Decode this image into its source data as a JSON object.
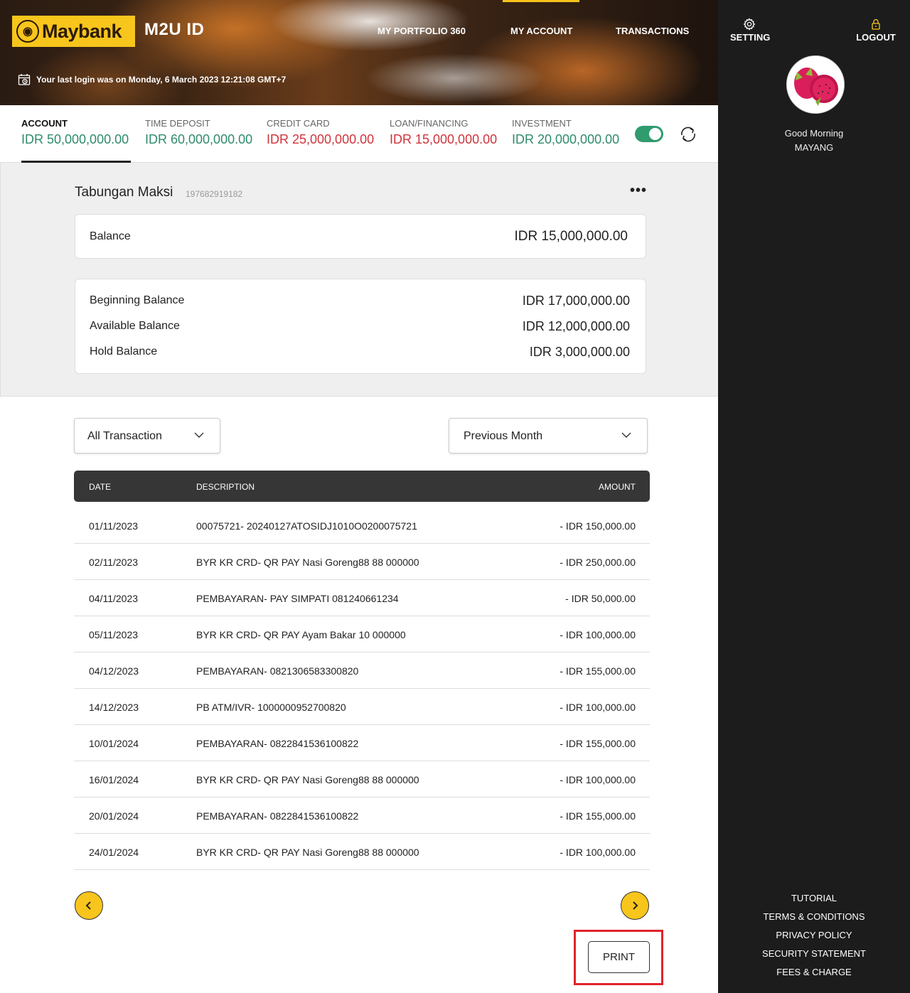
{
  "header": {
    "logo_text": "Maybank",
    "app_title": "M2U ID",
    "nav": [
      "MY PORTFOLIO 360",
      "MY ACCOUNT",
      "TRANSACTIONS"
    ],
    "last_login": "Your last login was on Monday, 6 March 2023 12:21:08 GMT+7"
  },
  "summary": {
    "tabs": [
      {
        "label": "ACCOUNT",
        "value": "IDR 50,000,000.00",
        "color": "#2f8b6b",
        "active": true
      },
      {
        "label": "TIME DEPOSIT",
        "value": "IDR 60,000,000.00",
        "color": "#2f8b6b"
      },
      {
        "label": "CREDIT CARD",
        "value": "IDR 25,000,000.00",
        "color": "#d0343b"
      },
      {
        "label": "LOAN/FINANCING",
        "value": "IDR 15,000,000.00",
        "color": "#d0343b"
      },
      {
        "label": "INVESTMENT",
        "value": "IDR 20,000,000.00",
        "color": "#2f8b6b"
      }
    ],
    "toggle_on": true
  },
  "account": {
    "name": "Tabungan Maksi",
    "number": "197682919182",
    "more_label": "•••",
    "balance_label": "Balance",
    "balance_value": "IDR 15,000,000.00",
    "details": [
      {
        "label": "Beginning Balance",
        "value": "IDR 17,000,000.00"
      },
      {
        "label": "Available Balance",
        "value": "IDR 12,000,000.00"
      },
      {
        "label": "Hold Balance",
        "value": "IDR 3,000,000.00"
      }
    ]
  },
  "filters": {
    "type_selected": "All Transaction",
    "period_selected": "Previous Month"
  },
  "table": {
    "headers": {
      "date": "DATE",
      "description": "DESCRIPTION",
      "amount": "AMOUNT"
    },
    "rows": [
      {
        "date": "01/11/2023",
        "description": "00075721- 20240127ATOSIDJ1010O0200075721",
        "amount": "- IDR 150,000.00"
      },
      {
        "date": "02/11/2023",
        "description": "BYR KR CRD- QR PAY Nasi Goreng88 88 000000",
        "amount": "- IDR 250,000.00"
      },
      {
        "date": "04/11/2023",
        "description": "PEMBAYARAN- PAY SIMPATI 081240661234",
        "amount": "- IDR 50,000.00"
      },
      {
        "date": "05/11/2023",
        "description": "BYR KR CRD- QR PAY Ayam Bakar 10 000000",
        "amount": "- IDR 100,000.00"
      },
      {
        "date": "04/12/2023",
        "description": "PEMBAYARAN- 0821306583300820",
        "amount": "- IDR 155,000.00"
      },
      {
        "date": "14/12/2023",
        "description": "PB ATM/IVR- 1000000952700820",
        "amount": "- IDR 100,000.00"
      },
      {
        "date": "10/01/2024",
        "description": "PEMBAYARAN- 0822841536100822",
        "amount": "- IDR 155,000.00"
      },
      {
        "date": "16/01/2024",
        "description": "BYR KR CRD- QR PAY Nasi Goreng88 88 000000",
        "amount": "- IDR 100,000.00"
      },
      {
        "date": "20/01/2024",
        "description": "PEMBAYARAN- 0822841536100822",
        "amount": "- IDR 155,000.00"
      },
      {
        "date": "24/01/2024",
        "description": "BYR KR CRD- QR PAY Nasi Goreng88 88 000000",
        "amount": "- IDR 100,000.00"
      }
    ]
  },
  "actions": {
    "print_label": "PRINT"
  },
  "sidebar": {
    "setting_label": "SETTING",
    "logout_label": "LOGOUT",
    "greeting": "Good Morning",
    "user_name": "MAYANG",
    "links": [
      "TUTORIAL",
      "TERMS & CONDITIONS",
      "PRIVACY POLICY",
      "SECURITY STATEMENT",
      "FEES & CHARGE"
    ]
  },
  "colors": {
    "brand_yellow": "#f8c51c",
    "positive": "#2f8b6b",
    "negative": "#d0343b",
    "highlight": "#e0232c"
  }
}
